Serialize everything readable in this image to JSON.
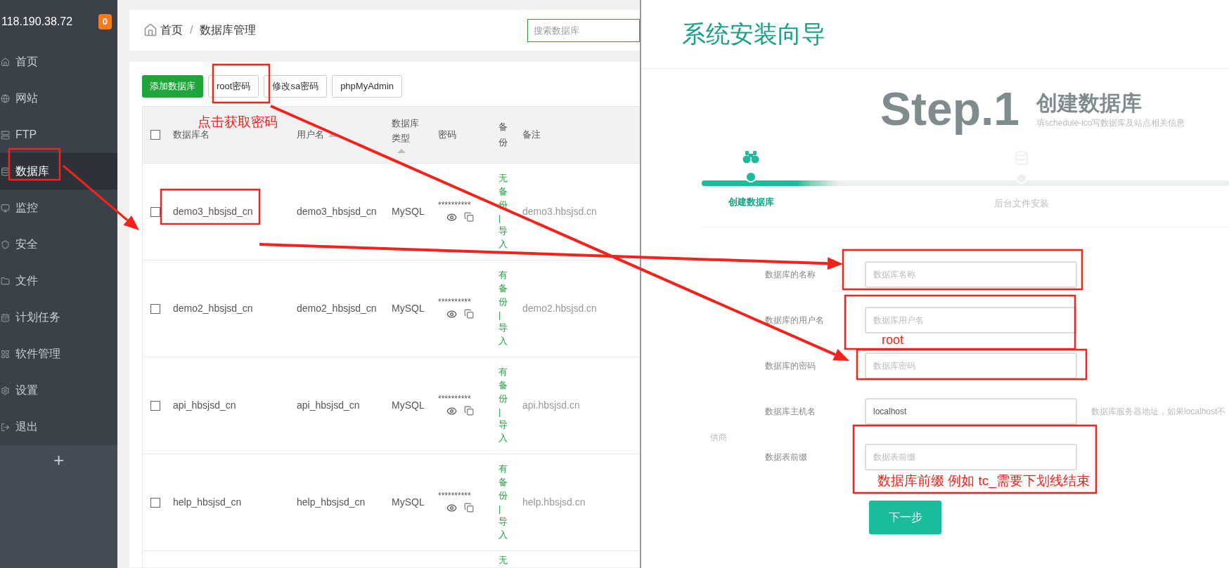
{
  "sidebar": {
    "host": "118.190.38.72",
    "badge": "0",
    "items": [
      {
        "label": "首页",
        "selected": false
      },
      {
        "label": "网站",
        "selected": false
      },
      {
        "label": "FTP",
        "selected": false
      },
      {
        "label": "数据库",
        "selected": true
      },
      {
        "label": "监控",
        "selected": false
      },
      {
        "label": "安全",
        "selected": false
      },
      {
        "label": "文件",
        "selected": false
      },
      {
        "label": "计划任务",
        "selected": false
      },
      {
        "label": "软件管理",
        "selected": false
      },
      {
        "label": "设置",
        "selected": false
      },
      {
        "label": "退出",
        "selected": false
      }
    ],
    "add": "+"
  },
  "breadcrumb": {
    "items": [
      "首页",
      "数据库管理"
    ],
    "separator": "/"
  },
  "search": {
    "placeholder": "搜索数据库"
  },
  "toolbar": [
    {
      "label": "添加数据库",
      "kind": "primary"
    },
    {
      "label": "root密码",
      "kind": "default"
    },
    {
      "label": "修改sa密码",
      "kind": "default"
    },
    {
      "label": "phpMyAdmin",
      "kind": "default"
    }
  ],
  "table": {
    "header_checked": false,
    "columns": [
      {
        "label": "数据库名",
        "sort": false
      },
      {
        "label": "用户名",
        "sort": true
      },
      {
        "label": "数据库类型",
        "sort": true
      },
      {
        "label": "密码",
        "sort": false
      },
      {
        "label": "备份",
        "sort": false
      },
      {
        "label": "备注",
        "sort": false
      }
    ],
    "rows": [
      {
        "name": "demo3_hbsjsd_cn",
        "user": "demo3_hbsjsd_cn",
        "type": "MySQL",
        "password": "**********",
        "backup": "无备份",
        "separator": "|",
        "action": "导入",
        "remark": "demo3.hbsjsd.cn",
        "checked": false
      },
      {
        "name": "demo2_hbsjsd_cn",
        "user": "demo2_hbsjsd_cn",
        "type": "MySQL",
        "password": "**********",
        "backup": "有备份",
        "separator": "|",
        "action": "导入",
        "remark": "demo2.hbsjsd.cn",
        "checked": false
      },
      {
        "name": "api_hbsjsd_cn",
        "user": "api_hbsjsd_cn",
        "type": "MySQL",
        "password": "**********",
        "backup": "有备份",
        "separator": "|",
        "action": "导入",
        "remark": "api.hbsjsd.cn",
        "checked": false
      },
      {
        "name": "help_hbsjsd_cn",
        "user": "help_hbsjsd_cn",
        "type": "MySQL",
        "password": "**********",
        "backup": "有备份",
        "separator": "|",
        "action": "导入",
        "remark": "help.hbsjsd.cn",
        "checked": false
      }
    ],
    "partial_row": {
      "backup": "无"
    }
  },
  "wizard": {
    "title": "系统安装向导",
    "step_number": "Step.1",
    "step_title": "创建数据库",
    "step_subtitle": "填schedule-ico写数据库及站点相关信息",
    "progress": {
      "level": 0.26
    },
    "steps": [
      {
        "label": "创建数据库",
        "selected": true
      },
      {
        "label": "后台文件安装",
        "selected": false
      }
    ],
    "fields": [
      {
        "label": "数据库的名称",
        "placeholder": "数据库名称"
      },
      {
        "label": "数据库的用户名",
        "placeholder": "数据库用户名"
      },
      {
        "label": "数据库的密码",
        "placeholder": "数据库密码"
      },
      {
        "label": "数据库主机名",
        "value": "localhost",
        "hint": "数据库服务器地址，如果localhost不",
        "hint_continued": "供商"
      },
      {
        "label": "数据表前缀",
        "placeholder": "数据表前缀"
      }
    ],
    "next": "下一步"
  },
  "annotations": [
    "点击获取密码",
    "root",
    "数据库前缀 例如 tc_需要下划线结束"
  ]
}
